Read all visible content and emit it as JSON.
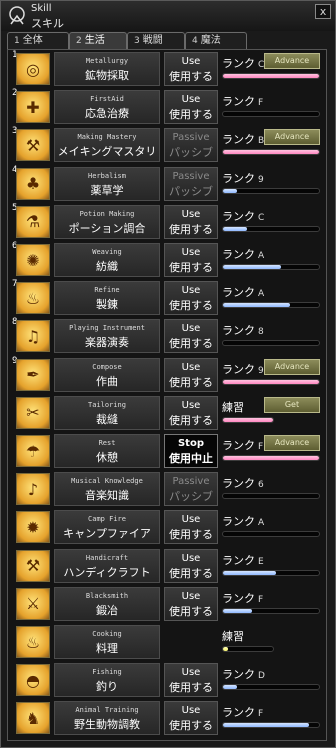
{
  "window": {
    "title_en": "Skill",
    "title_jp": "スキル",
    "close_label": "x"
  },
  "tabs": [
    {
      "num": "1",
      "label": "全体",
      "active": false
    },
    {
      "num": "2",
      "label": "生活",
      "active": true
    },
    {
      "num": "3",
      "label": "戦闘",
      "active": false
    },
    {
      "num": "4",
      "label": "魔法",
      "active": false
    }
  ],
  "colors": {
    "pink": "#ff86c0",
    "blue": "#8fb8ff",
    "yellow": "#f4f070",
    "advance": "#8c8c5a"
  },
  "skills": [
    {
      "num": "1",
      "name_en": "Metallurgy",
      "name_jp": "鉱物採取",
      "btn1": "Use",
      "btn2": "使用する",
      "btn_type": "use",
      "rank_label": "ランク",
      "rank_level": "C",
      "advance": "Advance",
      "progress": 1.0,
      "bar": "pink",
      "icon": "pan-icon",
      "glyph": "◎"
    },
    {
      "num": "2",
      "name_en": "FirstAid",
      "name_jp": "応急治療",
      "btn1": "Use",
      "btn2": "使用する",
      "btn_type": "use",
      "rank_label": "ランク",
      "rank_level": "F",
      "advance": "",
      "progress": 0.0,
      "bar": "blue",
      "icon": "bandage-icon",
      "glyph": "✚"
    },
    {
      "num": "3",
      "name_en": "Making Mastery",
      "name_jp": "メイキングマスタリ",
      "btn1": "Passive",
      "btn2": "パッシブ",
      "btn_type": "passive",
      "rank_label": "ランク",
      "rank_level": "B",
      "advance": "Advance",
      "progress": 1.0,
      "bar": "pink",
      "icon": "workbench-icon",
      "glyph": "⚒"
    },
    {
      "num": "4",
      "name_en": "Herbalism",
      "name_jp": "薬草学",
      "btn1": "Passive",
      "btn2": "パッシブ",
      "btn_type": "passive",
      "rank_label": "ランク",
      "rank_level": "9",
      "advance": "",
      "progress": 0.15,
      "bar": "blue",
      "icon": "clover-icon",
      "glyph": "♣"
    },
    {
      "num": "5",
      "name_en": "Potion Making",
      "name_jp": "ポーション調合",
      "btn1": "Use",
      "btn2": "使用する",
      "btn_type": "use",
      "rank_label": "ランク",
      "rank_level": "C",
      "advance": "",
      "progress": 0.25,
      "bar": "blue",
      "icon": "flask-icon",
      "glyph": "⚗"
    },
    {
      "num": "6",
      "name_en": "Weaving",
      "name_jp": "紡織",
      "btn1": "Use",
      "btn2": "使用する",
      "btn_type": "use",
      "rank_label": "ランク",
      "rank_level": "A",
      "advance": "",
      "progress": 0.6,
      "bar": "blue",
      "icon": "spindle-icon",
      "glyph": "✺"
    },
    {
      "num": "7",
      "name_en": "Refine",
      "name_jp": "製錬",
      "btn1": "Use",
      "btn2": "使用する",
      "btn_type": "use",
      "rank_label": "ランク",
      "rank_level": "A",
      "advance": "",
      "progress": 0.7,
      "bar": "blue",
      "icon": "furnace-icon",
      "glyph": "♨"
    },
    {
      "num": "8",
      "name_en": "Playing Instrument",
      "name_jp": "楽器演奏",
      "btn1": "Use",
      "btn2": "使用する",
      "btn_type": "use",
      "rank_label": "ランク",
      "rank_level": "8",
      "advance": "",
      "progress": 0.0,
      "bar": "blue",
      "icon": "lute-icon",
      "glyph": "♫"
    },
    {
      "num": "9",
      "name_en": "Compose",
      "name_jp": "作曲",
      "btn1": "Use",
      "btn2": "使用する",
      "btn_type": "use",
      "rank_label": "ランク",
      "rank_level": "9",
      "advance": "Advance",
      "progress": 1.0,
      "bar": "pink",
      "icon": "quill-icon",
      "glyph": "✒"
    },
    {
      "num": "",
      "name_en": "Tailoring",
      "name_jp": "裁縫",
      "btn1": "Use",
      "btn2": "使用する",
      "btn_type": "use",
      "rank_label": "練習",
      "rank_level": "",
      "advance": "Get",
      "progress": 1.0,
      "bar": "pink",
      "icon": "scissors-icon",
      "glyph": "✂",
      "short": true
    },
    {
      "num": "",
      "name_en": "Rest",
      "name_jp": "休憩",
      "btn1": "Stop",
      "btn2": "使用中止",
      "btn_type": "stop",
      "rank_label": "ランク",
      "rank_level": "F",
      "advance": "Advance",
      "progress": 1.0,
      "bar": "pink",
      "icon": "campfire-rest-icon",
      "glyph": "☂"
    },
    {
      "num": "",
      "name_en": "Musical Knowledge",
      "name_jp": "音楽知識",
      "btn1": "Passive",
      "btn2": "パッシブ",
      "btn_type": "passive",
      "rank_label": "ランク",
      "rank_level": "6",
      "advance": "",
      "progress": 0.0,
      "bar": "blue",
      "icon": "note-icon",
      "glyph": "♪"
    },
    {
      "num": "",
      "name_en": "Camp Fire",
      "name_jp": "キャンプファイア",
      "btn1": "Use",
      "btn2": "使用する",
      "btn_type": "use",
      "rank_label": "ランク",
      "rank_level": "A",
      "advance": "",
      "progress": 0.0,
      "bar": "blue",
      "icon": "fire-icon",
      "glyph": "✹"
    },
    {
      "num": "",
      "name_en": "Handicraft",
      "name_jp": "ハンディクラフト",
      "btn1": "Use",
      "btn2": "使用する",
      "btn_type": "use",
      "rank_label": "ランク",
      "rank_level": "E",
      "advance": "",
      "progress": 0.55,
      "bar": "blue",
      "icon": "hammer-icon",
      "glyph": "⚒"
    },
    {
      "num": "",
      "name_en": "Blacksmith",
      "name_jp": "鍛冶",
      "btn1": "Use",
      "btn2": "使用する",
      "btn_type": "use",
      "rank_label": "ランク",
      "rank_level": "F",
      "advance": "",
      "progress": 0.3,
      "bar": "blue",
      "icon": "anvil-icon",
      "glyph": "⚔"
    },
    {
      "num": "",
      "name_en": "Cooking",
      "name_jp": "料理",
      "btn1": "",
      "btn2": "",
      "btn_type": "none",
      "rank_label": "練習",
      "rank_level": "",
      "advance": "",
      "progress": 0.1,
      "bar": "yellow",
      "icon": "chef-hat-icon",
      "glyph": "♨",
      "short": true
    },
    {
      "num": "",
      "name_en": "Fishing",
      "name_jp": "釣り",
      "btn1": "Use",
      "btn2": "使用する",
      "btn_type": "use",
      "rank_label": "ランク",
      "rank_level": "D",
      "advance": "",
      "progress": 0.15,
      "bar": "blue",
      "icon": "fish-icon",
      "glyph": "◓"
    },
    {
      "num": "",
      "name_en": "Animal Training",
      "name_jp": "野生動物調教",
      "btn1": "Use",
      "btn2": "使用する",
      "btn_type": "use",
      "rank_label": "ランク",
      "rank_level": "F",
      "advance": "",
      "progress": 0.9,
      "bar": "blue",
      "icon": "animal-icon",
      "glyph": "♞"
    }
  ]
}
